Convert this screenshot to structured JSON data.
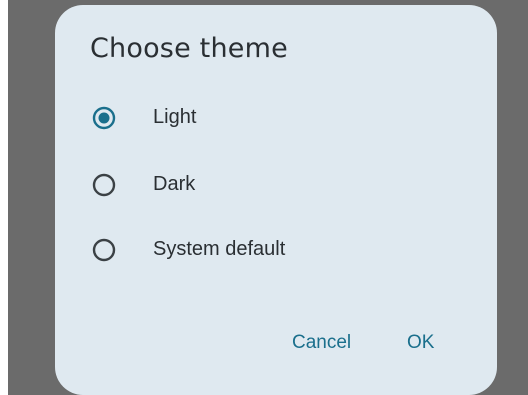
{
  "dialog": {
    "title": "Choose theme",
    "options": [
      {
        "label": "Light",
        "selected": true
      },
      {
        "label": "Dark",
        "selected": false
      },
      {
        "label": "System default",
        "selected": false
      }
    ],
    "cancel_label": "Cancel",
    "ok_label": "OK"
  },
  "colors": {
    "scrim": "#6b6b6b",
    "surface": "#dfe9f0",
    "accent": "#1a6f8c",
    "text": "#2a2f33",
    "radio_outline": "#3b4145"
  },
  "icons": {
    "selected": "radio-selected-icon",
    "unselected": "radio-unselected-icon"
  }
}
